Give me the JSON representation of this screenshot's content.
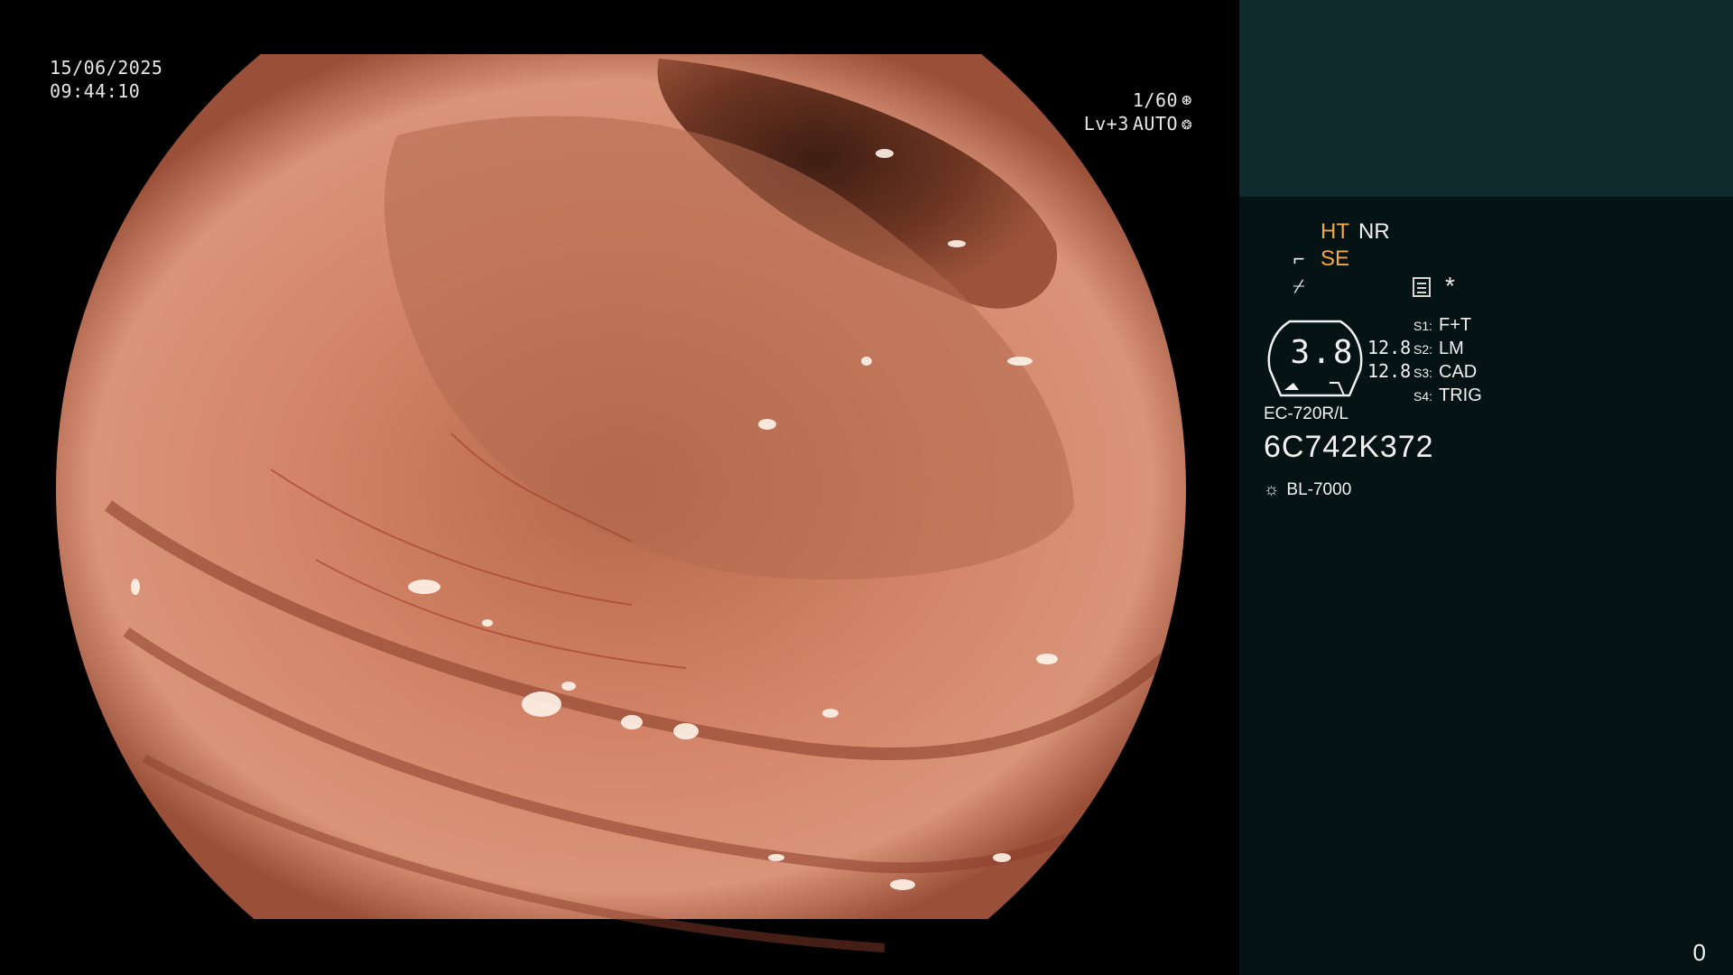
{
  "overlay": {
    "date": "15/06/2025",
    "time": "09:44:10",
    "shutter": "1/60",
    "shutter_icon": "aperture-icon",
    "level": "Lv+3",
    "iris_mode": "AUTO",
    "iris_icon": "iris-icon"
  },
  "panel": {
    "modes": {
      "ht": "HT",
      "nr": "NR",
      "se": "SE",
      "se_icon": "scope-tip-icon",
      "freeze_icon": "slash-icon"
    },
    "memo_star": "*",
    "gauge_value": "3.8",
    "levels": [
      "12.8",
      "12.8"
    ],
    "switches": [
      {
        "key": "S1:",
        "value": "F+T"
      },
      {
        "key": "S2:",
        "value": "LM"
      },
      {
        "key": "S3:",
        "value": "CAD"
      },
      {
        "key": "S4:",
        "value": "TRIG"
      }
    ],
    "scope_model": "EC-720R/L",
    "scope_serial": "6C742K372",
    "light_source_icon": "sun-icon",
    "light_source": "BL-7000",
    "page_number": "0"
  },
  "colors": {
    "accent_orange": "#f3a743",
    "panel_bg": "#061314",
    "preview_bg": "#0f2b2d"
  }
}
